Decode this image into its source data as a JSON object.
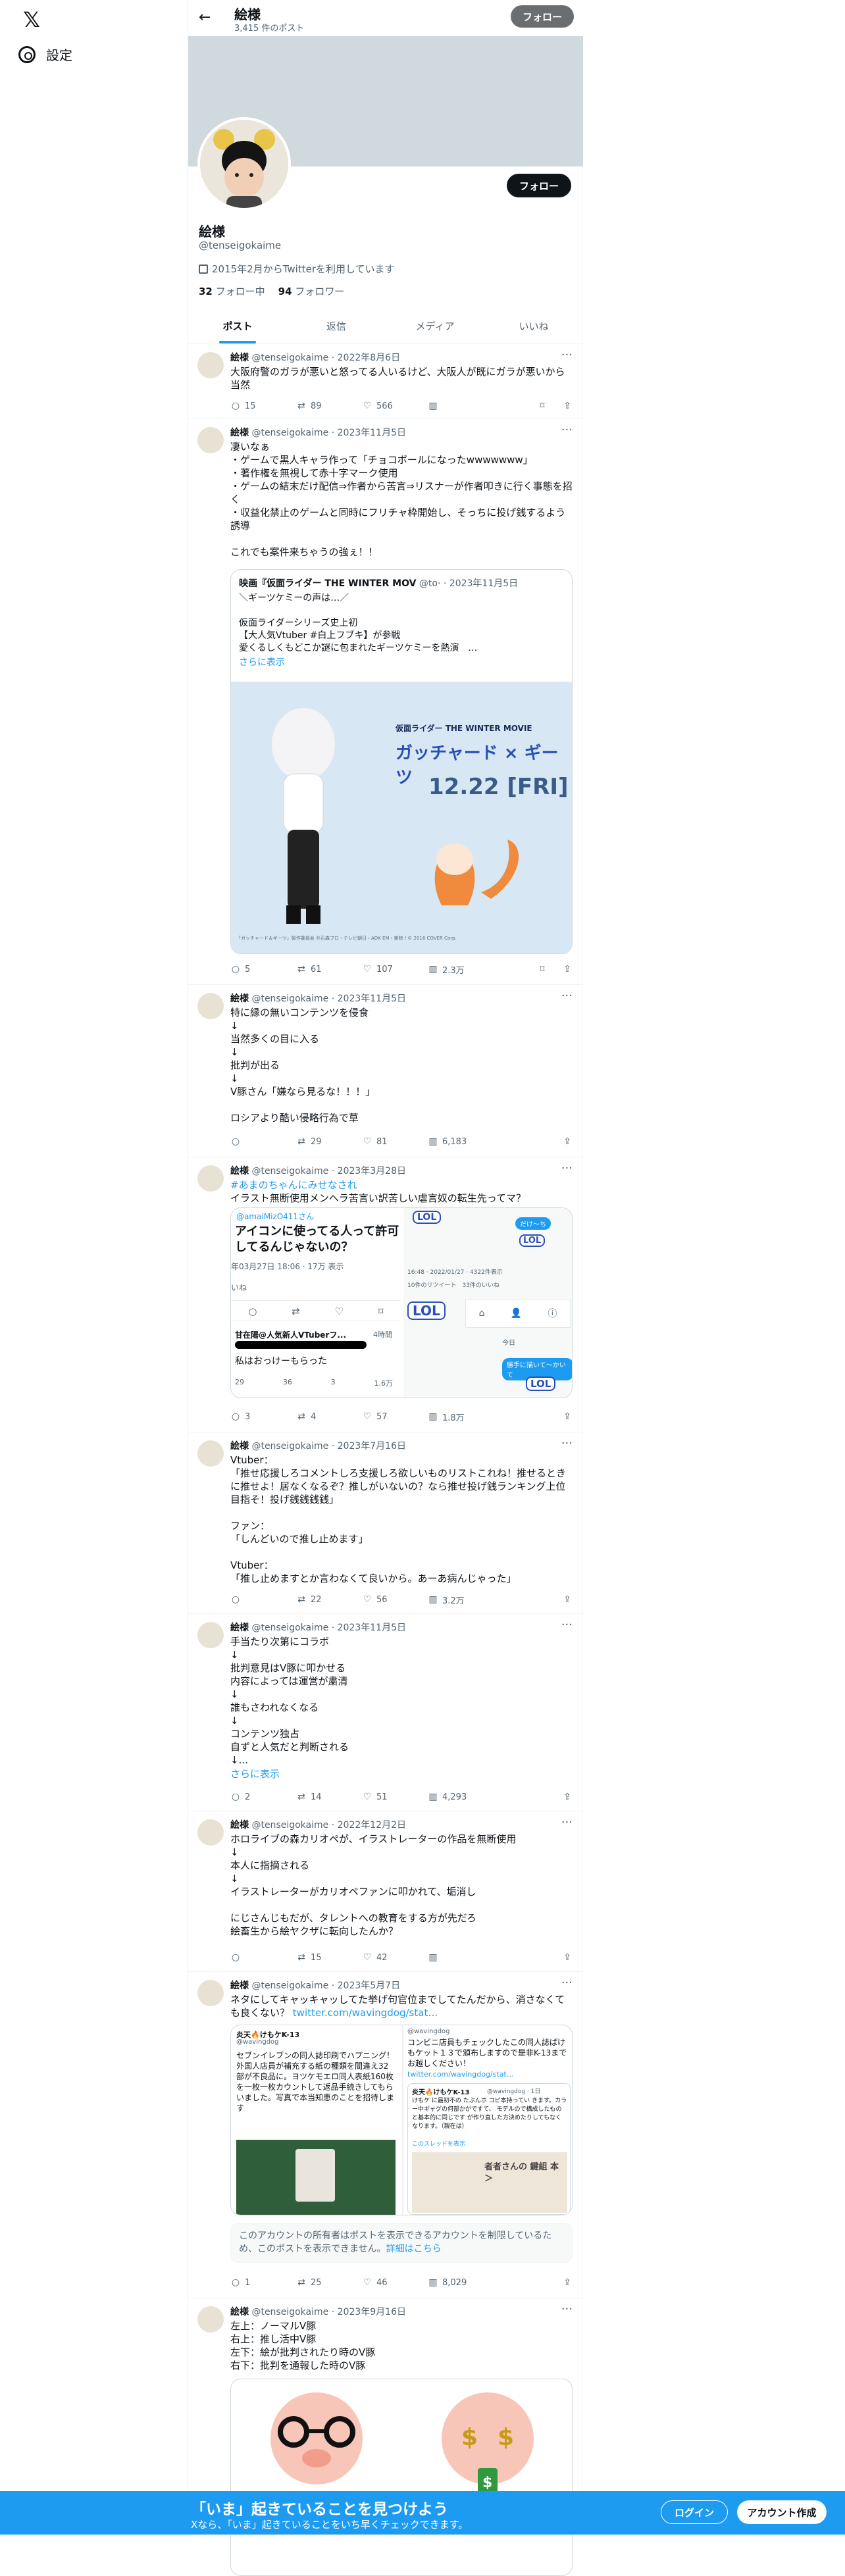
{
  "nav": {
    "logo": "𝕏",
    "settings": "設定"
  },
  "profile": {
    "name": "絵様",
    "post_count": "3,415 件のポスト",
    "handle": "@tenseigokaime",
    "joined": "2015年2月からTwitterを利用しています",
    "following_num": "32",
    "following_label": "フォロー中",
    "followers_num": "94",
    "followers_label": "フォロワー",
    "follow_label": "フォロー"
  },
  "tabs": [
    "ポスト",
    "返信",
    "メディア",
    "いいね"
  ],
  "posts": [
    {
      "name": "絵様",
      "handle": "@tenseigokaime",
      "date": "2022年8月6日",
      "text": "大阪府警のガラが悪いと怒ってる人いるけど、大阪人が既にガラが悪いから当然",
      "reply": "15",
      "repost": "89",
      "like": "566",
      "views": ""
    },
    {
      "name": "絵様",
      "handle": "@tenseigokaime",
      "date": "2023年11月5日",
      "text": "凄いなぁ\n・ゲームで黒人キャラ作って「チョコボールになったwwwwwww」\n・著作権を無視して赤十字マーク使用\n・ゲームの結末だけ配信⇒作者から苦言⇒リスナーが作者叩きに行く事態を招く\n・収益化禁止のゲームと同時にフリチャ枠開始し、そっちに投げ銭するよう誘導\n\nこれでも案件来ちゃうの強ぇ！！",
      "quote_name": "映画『仮面ライダー THE WINTER MOV",
      "quote_handle": "@to·",
      "quote_date": "2023年11月5日",
      "quote_text": "＼ギーツケミーの声は…／\n\n仮面ライダーシリーズ史上初\n【大人気Vtuber #白上フブキ】が参戦\n愛くるしくもどこか謎に包まれたギーツケミーを熱演　…",
      "quote_more": "さらに表示",
      "quote_image_title": "仮面ライダー THE WINTER MOVIE",
      "quote_image_logo": "ガッチャード × ギーツ",
      "quote_image_date": "12.22 [FRI]",
      "quote_image_credit": "「ガッチャード＆ギーツ」製作委員会 ©石森プロ・テレビ朝日・ADK EM・東映 / © 2016 COVER Corp.",
      "reply": "5",
      "repost": "61",
      "like": "107",
      "views": "2.3万"
    },
    {
      "name": "絵様",
      "handle": "@tenseigokaime",
      "date": "2023年11月5日",
      "text": "特に縁の無いコンテンツを侵食\n↓\n当然多くの目に入る\n↓\n批判が出る\n↓\nV豚さん「嫌なら見るな！！！」\n\nロシアより酷い侵略行為で草",
      "reply": "",
      "repost": "29",
      "like": "81",
      "views": "6,183"
    },
    {
      "name": "絵様",
      "handle": "@tenseigokaime",
      "date": "2023年3月28日",
      "hashtag": "#あまのちゃんにみせなされ",
      "text": "イラスト無断使用メンヘラ苦言い訳苦しい虐言奴の転生先ってマ？",
      "shot_handle": "@amaiMizO411さん",
      "shot_title": "アイコンに使ってる人って許可してるんじゃないの？",
      "shot_time": "年03月27日 18:06 · 17万 表示",
      "shot_like_label": "いね",
      "shot_sub_user": "甘在陽@人気新人VTuberフ...",
      "shot_sub_time": "4時間",
      "shot_sub_text": "私はおっけーもらった",
      "shot_lol": "LOL",
      "shot_sub_stats": [
        "29",
        "36",
        "3",
        "1.6万"
      ],
      "shot_right_meta": "16:48 · 2022/01/27 · 4322件表示",
      "shot_right_counts": "10件のリツイート　33件のいいね",
      "shot_right_today": "今日",
      "shot_right_bubble1": "だけ〜ち",
      "shot_right_bubble2": "勝手に描いて〜かいて",
      "reply": "3",
      "repost": "4",
      "like": "57",
      "views": "1.8万"
    },
    {
      "name": "絵様",
      "handle": "@tenseigokaime",
      "date": "2023年7月16日",
      "text": "Vtuber：\n「推せ応援しろコメントしろ支援しろ欲しいものリストこれね！推せるときに推せよ！居なくなるぞ？推しがいないの？なら推せ投げ銭ランキング上位目指そ！投げ銭銭銭銭」\n\nファン：\n「しんどいので推し止めます」\n\nVtuber：\n「推し止めますとか言わなくて良いから。あーあ病んじゃった」",
      "reply": "",
      "repost": "22",
      "like": "56",
      "views": "3.2万"
    },
    {
      "name": "絵様",
      "handle": "@tenseigokaime",
      "date": "2023年11月5日",
      "text": "手当たり次第にコラボ\n↓\n批判意見はV豚に叩かせる\n内容によっては運営が粛清\n↓\n誰もさわれなくなる\n↓\nコンテンツ独占\n自ずと人気だと判断される\n↓...",
      "more": "さらに表示",
      "reply": "2",
      "repost": "14",
      "like": "51",
      "views": "4,293"
    },
    {
      "name": "絵様",
      "handle": "@tenseigokaime",
      "date": "2022年12月2日",
      "text": "ホロライブの森カリオペが、イラストレーターの作品を無断使用\n↓\n本人に指摘される\n↓\nイラストレーターがカリオペファンに叩かれて、垢消し\n\nにじさんじもだが、タレントへの教育をする方が先だろ\n絵畜生から絵ヤクザに転向したんか？",
      "reply": "",
      "repost": "15",
      "like": "42",
      "views": ""
    },
    {
      "name": "絵様",
      "handle": "@tenseigokaime",
      "date": "2023年5月7日",
      "text": "ネタにしてキャッキャッしてた挙げ句官位までしてたんだから、消さなくても良くない？",
      "link": "twitter.com/wavingdog/stat…",
      "shotA_user": "炎天🔥けもケK-13",
      "shotA_handle": "@wavingdog",
      "shotA_text": "セブンイレブンの同人誌印刷でハプニング！\n外国人店員が補充する紙の種類を間違え32部が不良品に。ヨツケモエロ同人表紙160枚を一枚一枚カウントして返品手続きしてもらいました。写真で本当知恵のことを招待します",
      "shotB_handle": "@wavingdog",
      "shotB_text": "コンビニ店員もチェックしたこの同人誌ぱけもケット１３で頒布しますので是非K-13までお越しください！",
      "shotB_link": "twitter.com/wavingdog/stat…",
      "shotB_inner_user": "炎天🔥けもケK-13",
      "shotB_inner_handle": "@wavingdog · 1日",
      "shotB_inner_text": "けもケ に最初不の たぶんホ コピ本持ってい きます。カラー中ギャグの何部かがですて、 モデルので構成したものと基本的に同じです が作り直した方決めたりしてもなくなります。（親在は）",
      "shotB_inner_more": "このスレッドを表示",
      "shotB_book": "者者さんの 鍵組 本 ＞",
      "notice": "このアカウントの所有者はポストを表示できるアカウントを制限しているため、このポストを表示できません。",
      "notice_link": "詳細はこちら",
      "reply": "1",
      "repost": "25",
      "like": "46",
      "views": "8,029"
    },
    {
      "name": "絵様",
      "handle": "@tenseigokaime",
      "date": "2023年9月16日",
      "text": "左上：ノーマルV豚\n右上：推し活中V豚\n左下：絵が批判されたり時のV豚\n右下：批判を通報した時のV豚",
      "reply": "",
      "repost": "",
      "like": "",
      "views": ""
    }
  ],
  "bottom_bar": {
    "title": "「いま」起きていることを見つけよう",
    "subtitle": "Xなら、「いま」起きていることをいち早くチェックできます。",
    "login": "ログイン",
    "signup": "アカウント作成"
  },
  "colors": {
    "accent": "#1d9bf0",
    "text": "#0f1419",
    "muted": "#536471",
    "border": "#eff3f4",
    "banner": "#cfd9de"
  }
}
